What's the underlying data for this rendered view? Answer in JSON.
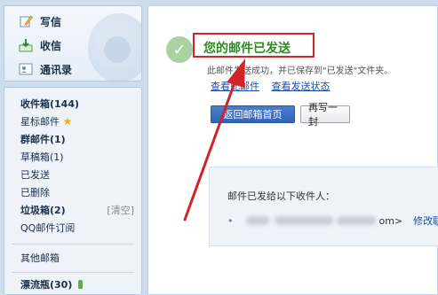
{
  "compose": {
    "write_label": "写信",
    "receive_label": "收信",
    "contacts_label": "通讯录"
  },
  "folders": {
    "inbox": "收件箱(144)",
    "starred": "星标邮件",
    "group": "群邮件(1)",
    "drafts": "草稿箱(1)",
    "sent": "已发送",
    "deleted": "已删除",
    "spam": "垃圾箱(2)",
    "spam_clear": "[清空]",
    "subscriptions": "QQ邮件订阅",
    "other": "其他邮箱",
    "drift_bottle": "漂流瓶(30)"
  },
  "main": {
    "success_title": "您的邮件已发送",
    "description": "此邮件发送成功，并已保存到\"已发送\"文件夹。",
    "view_mail_link": "查看此邮件",
    "view_status_link": "查看发送状态",
    "back_button": "返回邮箱首页",
    "rewrite_button": "再写一封",
    "recipients_label": "邮件已发给以下收件人：",
    "recipient_suffix": "om>",
    "edit_contact_link": "修改联系"
  },
  "colors": {
    "success_green": "#2c8c1f",
    "annotation_red": "#d3222a",
    "link_blue": "#1d4ea8"
  }
}
